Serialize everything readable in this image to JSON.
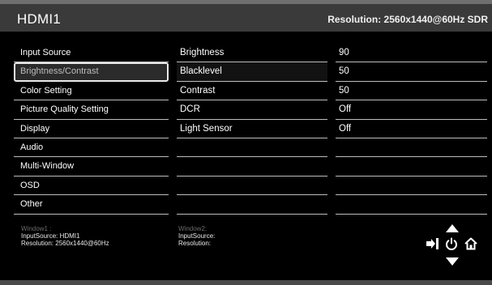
{
  "header": {
    "title": "HDMI1",
    "resolution": "Resolution: 2560x1440@60Hz SDR"
  },
  "menu": {
    "items": [
      {
        "label": "Input Source"
      },
      {
        "label": "Brightness/Contrast",
        "selected": true
      },
      {
        "label": "Color Setting"
      },
      {
        "label": "Picture Quality Setting"
      },
      {
        "label": "Display"
      },
      {
        "label": "Audio"
      },
      {
        "label": "Multi-Window"
      },
      {
        "label": "OSD"
      },
      {
        "label": "Other"
      }
    ]
  },
  "settings": {
    "rows": [
      {
        "label": "Brightness",
        "value": "90"
      },
      {
        "label": "Blacklevel",
        "value": "50"
      },
      {
        "label": "Contrast",
        "value": "50"
      },
      {
        "label": "DCR",
        "value": "Off"
      },
      {
        "label": "Light Sensor",
        "value": "Off"
      },
      {
        "label": "",
        "value": ""
      },
      {
        "label": "",
        "value": ""
      },
      {
        "label": "",
        "value": ""
      },
      {
        "label": "",
        "value": ""
      }
    ]
  },
  "footer": {
    "window1": {
      "title": "Window1 :",
      "input": "InputSource: HDMI1",
      "resolution": "Resolution: 2560x1440@60Hz"
    },
    "window2": {
      "title": "Window2:",
      "input": "InputSource:",
      "resolution": "Resolution:"
    }
  },
  "icons": [
    "up-arrow-icon",
    "down-arrow-icon",
    "exit-icon",
    "power-icon",
    "home-icon"
  ],
  "colors": {
    "background": "#000000",
    "header": "#3a3a3a",
    "divider": "#bdbdbd",
    "selected_text": "#bdbdbd",
    "footer_label": "#6c6c6c"
  }
}
